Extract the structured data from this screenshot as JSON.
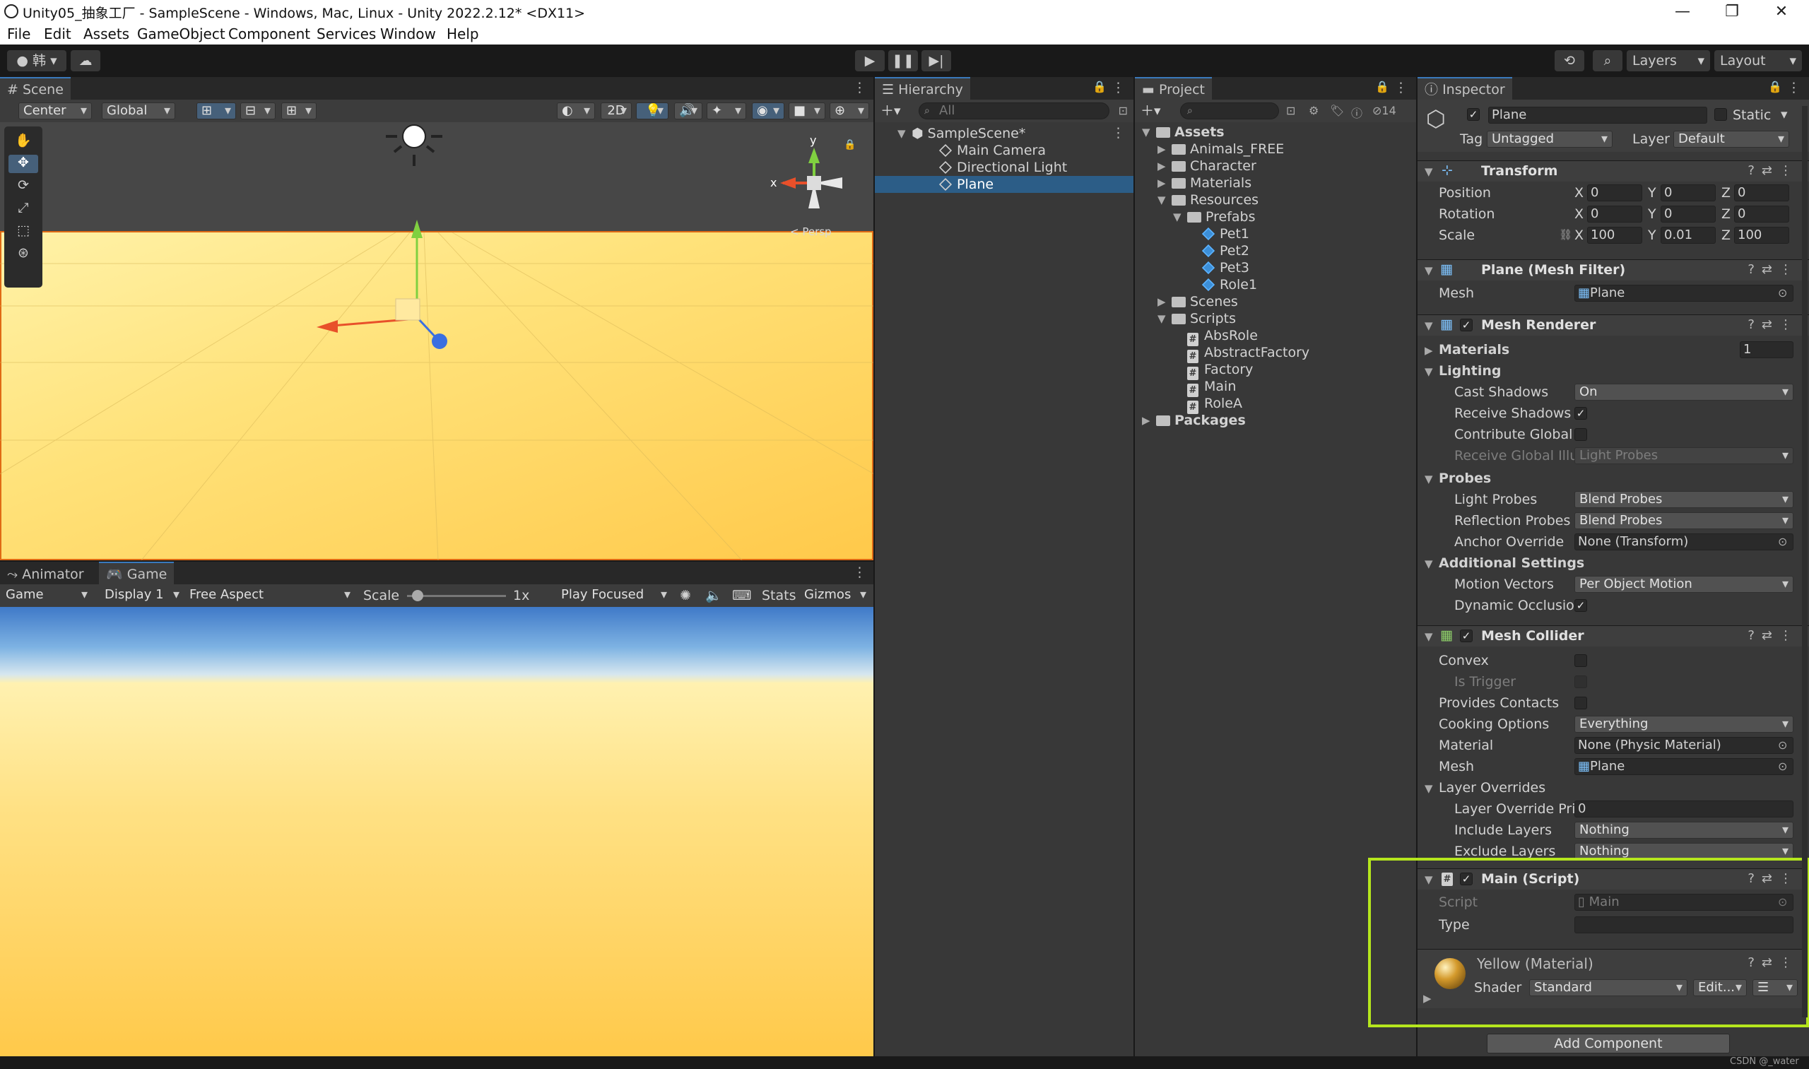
{
  "window": {
    "title": "Unity05_抽象工厂 - SampleScene - Windows, Mac, Linux - Unity 2022.2.12* <DX11>",
    "minimize": "—",
    "maximize": "❐",
    "close": "✕"
  },
  "menu": [
    "File",
    "Edit",
    "Assets",
    "GameObject",
    "Component",
    "Services",
    "Window",
    "Help"
  ],
  "toolbar": {
    "account": "韩 ▾",
    "layers": "Layers",
    "layout": "Layout"
  },
  "scene": {
    "tab": "Scene",
    "pivot": "Center",
    "space": "Global",
    "mode_2d": "2D",
    "persp": "< Persp",
    "axis_y": "y",
    "axis_x": "x"
  },
  "game": {
    "tab_animator": "Animator",
    "tab_game": "Game",
    "view_select": "Game",
    "display": "Display 1",
    "aspect": "Free Aspect",
    "scale_label": "Scale",
    "scale_value": "1x",
    "play_mode": "Play Focused",
    "stats": "Stats",
    "gizmos": "Gizmos",
    "scale_level": 0.05
  },
  "hierarchy": {
    "tab": "Hierarchy",
    "search_placeholder": "All",
    "scene": "SampleScene*",
    "items": [
      "Main Camera",
      "Directional Light",
      "Plane"
    ],
    "selected": "Plane"
  },
  "project": {
    "tab": "Project",
    "hidden_count": "14",
    "tree": [
      {
        "name": "Assets",
        "depth": 0,
        "type": "folder",
        "open": true,
        "bold": true
      },
      {
        "name": "Animals_FREE",
        "depth": 1,
        "type": "folder",
        "open": false
      },
      {
        "name": "Character",
        "depth": 1,
        "type": "folder",
        "open": false
      },
      {
        "name": "Materials",
        "depth": 1,
        "type": "folder",
        "open": false
      },
      {
        "name": "Resources",
        "depth": 1,
        "type": "folder",
        "open": true
      },
      {
        "name": "Prefabs",
        "depth": 2,
        "type": "folder",
        "open": true
      },
      {
        "name": "Pet1",
        "depth": 3,
        "type": "prefab"
      },
      {
        "name": "Pet2",
        "depth": 3,
        "type": "prefab"
      },
      {
        "name": "Pet3",
        "depth": 3,
        "type": "prefab"
      },
      {
        "name": "Role1",
        "depth": 3,
        "type": "prefab"
      },
      {
        "name": "Scenes",
        "depth": 1,
        "type": "folder",
        "open": false
      },
      {
        "name": "Scripts",
        "depth": 1,
        "type": "folder",
        "open": true
      },
      {
        "name": "AbsRole",
        "depth": 2,
        "type": "script"
      },
      {
        "name": "AbstractFactory",
        "depth": 2,
        "type": "script"
      },
      {
        "name": "Factory",
        "depth": 2,
        "type": "script"
      },
      {
        "name": "Main",
        "depth": 2,
        "type": "script"
      },
      {
        "name": "RoleA",
        "depth": 2,
        "type": "script"
      },
      {
        "name": "Packages",
        "depth": 0,
        "type": "folder",
        "open": false,
        "bold": true
      }
    ]
  },
  "inspector": {
    "tab": "Inspector",
    "object_name": "Plane",
    "static_label": "Static",
    "tag_label": "Tag",
    "tag_value": "Untagged",
    "layer_label": "Layer",
    "layer_value": "Default",
    "transform": {
      "title": "Transform",
      "rows": [
        {
          "label": "Position",
          "x": "0",
          "y": "0",
          "z": "0"
        },
        {
          "label": "Rotation",
          "x": "0",
          "y": "0",
          "z": "0"
        },
        {
          "label": "Scale",
          "x": "100",
          "y": "0.01",
          "z": "100"
        }
      ]
    },
    "mesh_filter": {
      "title": "Plane (Mesh Filter)",
      "mesh_label": "Mesh",
      "mesh_value": "Plane"
    },
    "mesh_renderer": {
      "title": "Mesh Renderer",
      "materials_label": "Materials",
      "materials_count": "1",
      "lighting": "Lighting",
      "cast_shadows_label": "Cast Shadows",
      "cast_shadows": "On",
      "receive_shadows_label": "Receive Shadows",
      "contribute_gi_label": "Contribute Global I",
      "receive_gi_label": "Receive Global Illu",
      "receive_gi_value": "Light Probes",
      "probes": "Probes",
      "light_probes_label": "Light Probes",
      "light_probes": "Blend Probes",
      "reflection_probes_label": "Reflection Probes",
      "reflection_probes": "Blend Probes",
      "anchor_label": "Anchor Override",
      "anchor_value": "None (Transform)",
      "additional": "Additional Settings",
      "motion_vectors_label": "Motion Vectors",
      "motion_vectors": "Per Object Motion",
      "dynamic_occlusion_label": "Dynamic Occlusior"
    },
    "mesh_collider": {
      "title": "Mesh Collider",
      "convex": "Convex",
      "is_trigger": "Is Trigger",
      "provides_contacts": "Provides Contacts",
      "cooking_label": "Cooking Options",
      "cooking": "Everything",
      "material_label": "Material",
      "material": "None (Physic Material)",
      "mesh_label": "Mesh",
      "mesh": "Plane",
      "layer_overrides": "Layer Overrides",
      "layer_priority_label": "Layer Override Pric",
      "layer_priority": "0",
      "include_label": "Include Layers",
      "include": "Nothing",
      "exclude_label": "Exclude Layers",
      "exclude": "Nothing"
    },
    "main_script": {
      "title": "Main (Script)",
      "script_label": "Script",
      "script_value": "Main",
      "type_label": "Type"
    },
    "material": {
      "title": "Yellow (Material)",
      "shader_label": "Shader",
      "shader": "Standard",
      "edit": "Edit..."
    },
    "add_component": "Add Component"
  },
  "watermark": "CSDN @_water",
  "colors": {
    "highlight": "#b5e61d",
    "selection": "#2c5d87",
    "accent": "#3a79bb",
    "ground": "#ffd35c"
  }
}
